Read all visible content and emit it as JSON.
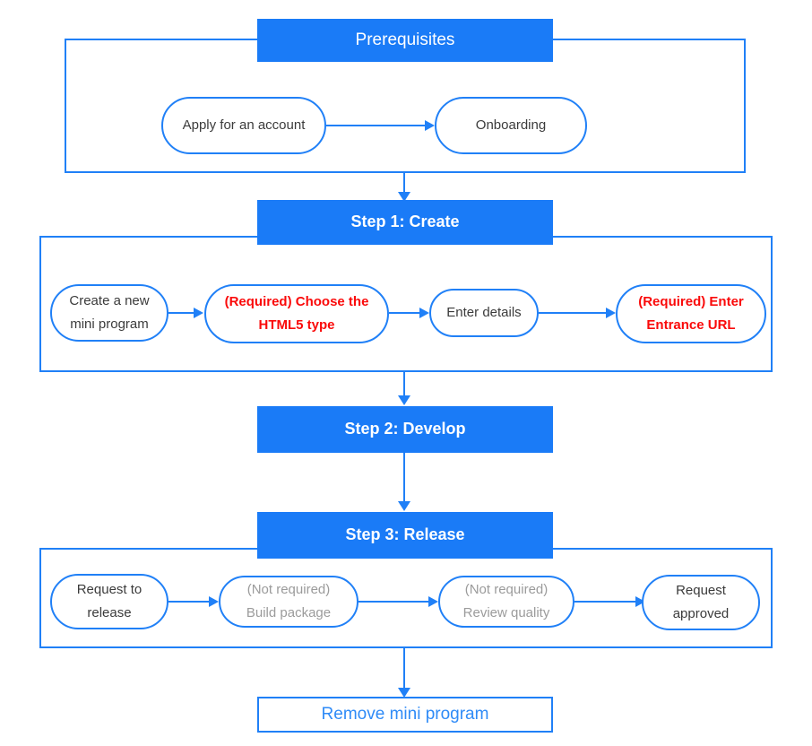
{
  "diagram": {
    "title": "Mini program lifecycle flowchart",
    "colors": {
      "accent_blue": "#1a7bf7",
      "border_blue": "#2080f7",
      "link_blue": "#2f8bf7",
      "required_red": "#fa0a0a",
      "not_required_gray": "#9b9b9b",
      "node_text": "#3b3b3b",
      "header_text": "#ffffff",
      "background": "#ffffff"
    },
    "sections": [
      {
        "id": "prerequisites",
        "header": "Prerequisites",
        "header_style": "plain",
        "nodes": [
          {
            "id": "apply-for-an-account",
            "lines": [
              "Apply for an account"
            ],
            "style": "normal"
          },
          {
            "id": "onboarding",
            "lines": [
              "Onboarding"
            ],
            "style": "normal"
          }
        ]
      },
      {
        "id": "step-1-create",
        "header": "Step 1: Create",
        "header_style": "bold",
        "nodes": [
          {
            "id": "create-a-new-mini-program",
            "lines": [
              "Create a new",
              "mini program"
            ],
            "style": "normal"
          },
          {
            "id": "choose-the-html5-type",
            "lines": [
              "(Required) Choose the",
              "HTML5 type"
            ],
            "style": "required"
          },
          {
            "id": "enter-details",
            "lines": [
              "Enter details"
            ],
            "style": "normal"
          },
          {
            "id": "enter-entrance-url",
            "lines": [
              "(Required) Enter",
              "Entrance URL"
            ],
            "style": "required"
          }
        ]
      },
      {
        "id": "step-2-develop",
        "header": "Step 2: Develop",
        "header_style": "bold",
        "nodes": []
      },
      {
        "id": "step-3-release",
        "header": "Step 3:  Release",
        "header_style": "bold",
        "nodes": [
          {
            "id": "request-to-release",
            "lines": [
              "Request to",
              "release"
            ],
            "style": "normal"
          },
          {
            "id": "build-package",
            "lines": [
              "(Not required)",
              "Build package"
            ],
            "style": "not-required"
          },
          {
            "id": "review-quality",
            "lines": [
              "(Not required)",
              "Review quality"
            ],
            "style": "not-required"
          },
          {
            "id": "request-approved",
            "lines": [
              "Request",
              "approved"
            ],
            "style": "normal"
          }
        ]
      }
    ],
    "footer_node": {
      "id": "remove-mini-program",
      "label": "Remove mini program"
    }
  },
  "prereq": {
    "header": "Prerequisites",
    "node1_line1": "Apply for an account",
    "node2_line1": "Onboarding"
  },
  "step1": {
    "header": "Step 1: Create",
    "node1_line1": "Create a new",
    "node1_line2": "mini program",
    "node2_line1": "(Required) Choose the",
    "node2_line2": "HTML5 type",
    "node3_line1": "Enter details",
    "node4_line1": "(Required) Enter",
    "node4_line2": "Entrance URL"
  },
  "step2": {
    "header": "Step 2: Develop"
  },
  "step3": {
    "header": "Step 3:  Release",
    "node1_line1": "Request to",
    "node1_line2": "release",
    "node2_line1": "(Not required)",
    "node2_line2": "Build package",
    "node3_line1": "(Not required)",
    "node3_line2": "Review quality",
    "node4_line1": "Request",
    "node4_line2": "approved"
  },
  "footer": {
    "label": "Remove mini program"
  }
}
